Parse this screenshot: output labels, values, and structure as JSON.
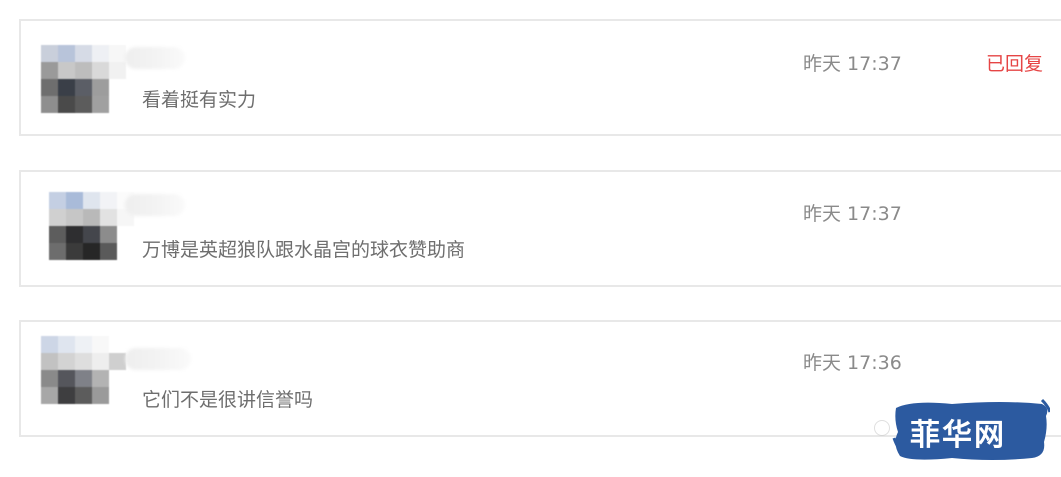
{
  "comments": [
    {
      "content": "看着挺有实力",
      "time": "昨天 17:37",
      "status": "已回复"
    },
    {
      "content": "万博是英超狼队跟水晶宫的球衣赞助商",
      "time": "昨天 17:37",
      "status": ""
    },
    {
      "content": "它们不是很讲信誉吗",
      "time": "昨天 17:36",
      "status": ""
    }
  ],
  "watermark": {
    "text": "菲华网"
  },
  "colors": {
    "replied": "#e64545",
    "content_text": "#6e6e6e",
    "time_text": "#8a8a8a",
    "card_border": "#e8e8e8",
    "watermark_blue": "#2c5aa0"
  }
}
